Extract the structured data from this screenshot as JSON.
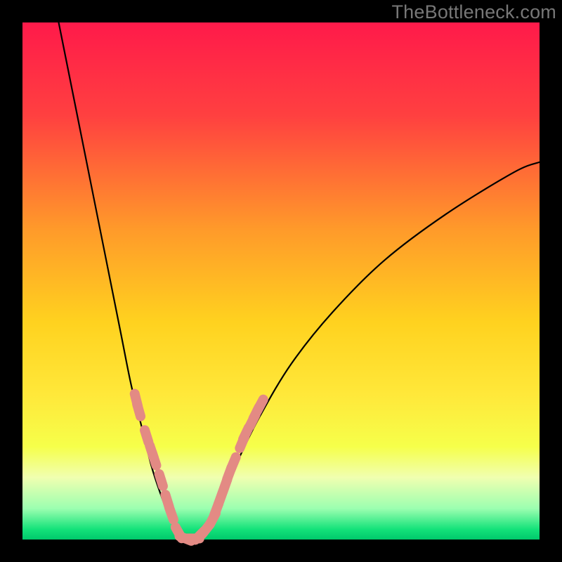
{
  "watermark": "TheBottleneck.com",
  "chart_data": {
    "type": "line",
    "title": "",
    "xlabel": "",
    "ylabel": "",
    "xlim": [
      0,
      100
    ],
    "ylim": [
      0,
      100
    ],
    "annotations": [],
    "background_gradient_stops": [
      {
        "offset": 0.0,
        "color": "#ff1a4a"
      },
      {
        "offset": 0.18,
        "color": "#ff4040"
      },
      {
        "offset": 0.4,
        "color": "#ff9a2a"
      },
      {
        "offset": 0.58,
        "color": "#ffd21f"
      },
      {
        "offset": 0.72,
        "color": "#ffe83a"
      },
      {
        "offset": 0.82,
        "color": "#f6ff4a"
      },
      {
        "offset": 0.88,
        "color": "#f0ffb0"
      },
      {
        "offset": 0.94,
        "color": "#9cffb0"
      },
      {
        "offset": 0.98,
        "color": "#14e27a"
      },
      {
        "offset": 1.0,
        "color": "#00c96c"
      }
    ],
    "series": [
      {
        "name": "bottleneck-curve",
        "color": "#000000",
        "points": [
          {
            "x": 7,
            "y": 100
          },
          {
            "x": 10,
            "y": 85
          },
          {
            "x": 13,
            "y": 70
          },
          {
            "x": 16,
            "y": 55
          },
          {
            "x": 19,
            "y": 40
          },
          {
            "x": 21,
            "y": 30
          },
          {
            "x": 23,
            "y": 22
          },
          {
            "x": 25,
            "y": 14
          },
          {
            "x": 27,
            "y": 8
          },
          {
            "x": 29,
            "y": 3
          },
          {
            "x": 31,
            "y": 0
          },
          {
            "x": 33,
            "y": 0
          },
          {
            "x": 35,
            "y": 1
          },
          {
            "x": 37,
            "y": 4
          },
          {
            "x": 39,
            "y": 9
          },
          {
            "x": 42,
            "y": 16
          },
          {
            "x": 46,
            "y": 24
          },
          {
            "x": 52,
            "y": 34
          },
          {
            "x": 60,
            "y": 44
          },
          {
            "x": 70,
            "y": 54
          },
          {
            "x": 82,
            "y": 63
          },
          {
            "x": 95,
            "y": 71
          },
          {
            "x": 100,
            "y": 73
          }
        ]
      },
      {
        "name": "highlight-dots-left",
        "color": "#e38a84",
        "points": [
          {
            "x": 22.0,
            "y": 27.0
          },
          {
            "x": 22.5,
            "y": 25.0
          },
          {
            "x": 24.0,
            "y": 20.0
          },
          {
            "x": 25.0,
            "y": 17.0
          },
          {
            "x": 25.5,
            "y": 15.5
          },
          {
            "x": 26.8,
            "y": 11.5
          },
          {
            "x": 28.0,
            "y": 7.5
          },
          {
            "x": 28.8,
            "y": 5.0
          },
          {
            "x": 30.2,
            "y": 1.3
          },
          {
            "x": 31.5,
            "y": 0.2
          },
          {
            "x": 33.0,
            "y": 0.2
          }
        ]
      },
      {
        "name": "highlight-dots-right",
        "color": "#e38a84",
        "points": [
          {
            "x": 34.3,
            "y": 0.8
          },
          {
            "x": 35.5,
            "y": 2.0
          },
          {
            "x": 36.8,
            "y": 4.0
          },
          {
            "x": 37.5,
            "y": 5.8
          },
          {
            "x": 38.3,
            "y": 8.0
          },
          {
            "x": 39.2,
            "y": 10.5
          },
          {
            "x": 40.0,
            "y": 12.8
          },
          {
            "x": 40.8,
            "y": 14.8
          },
          {
            "x": 42.5,
            "y": 18.8
          },
          {
            "x": 43.2,
            "y": 20.5
          },
          {
            "x": 44.5,
            "y": 23.0
          },
          {
            "x": 45.2,
            "y": 24.5
          },
          {
            "x": 46.0,
            "y": 26.0
          }
        ]
      }
    ]
  }
}
